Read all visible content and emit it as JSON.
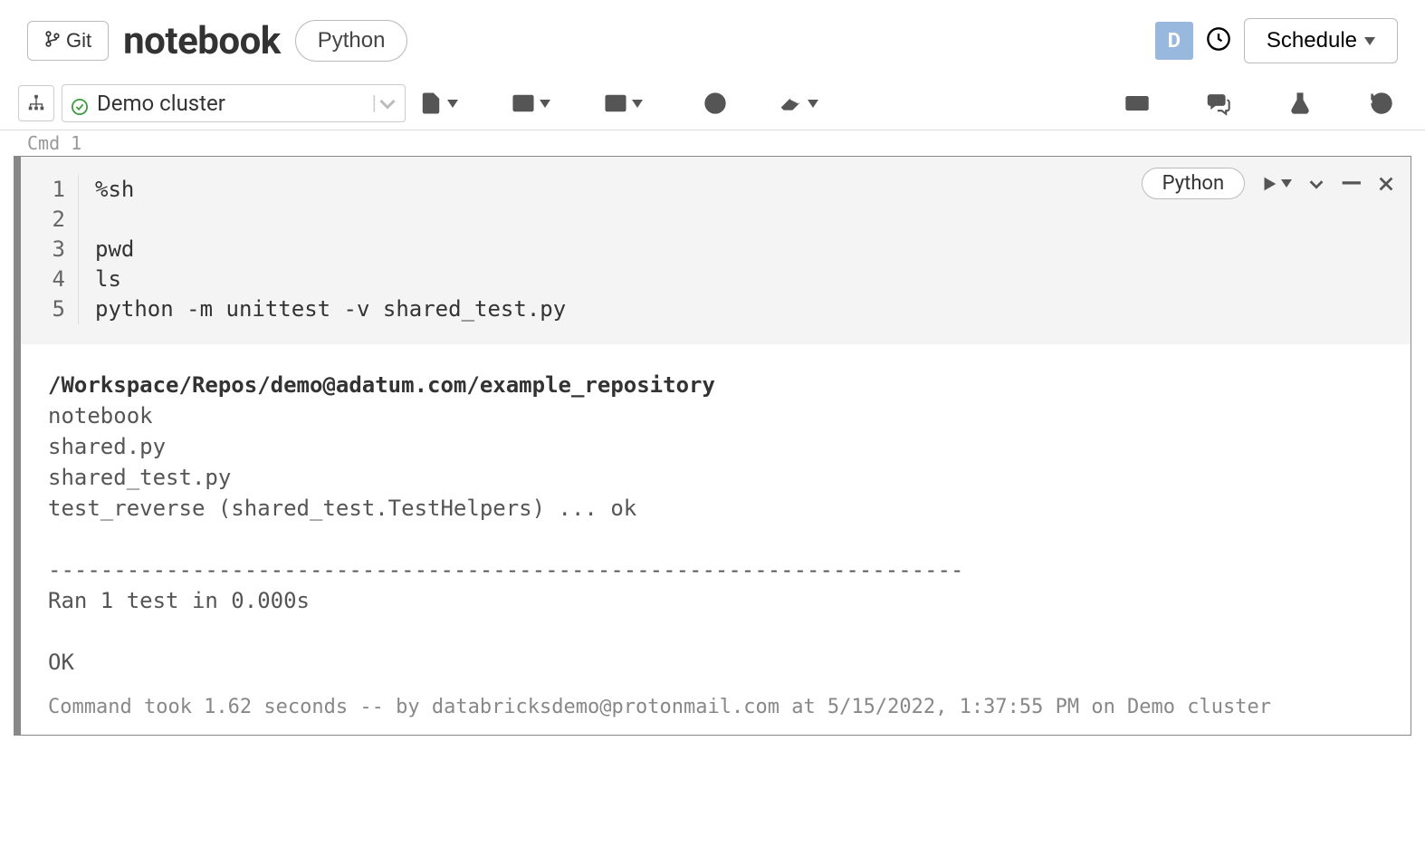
{
  "header": {
    "git_label": "Git",
    "title": "notebook",
    "language": "Python",
    "avatar_letter": "D",
    "schedule_label": "Schedule"
  },
  "toolbar": {
    "cluster_name": "Demo cluster"
  },
  "cmd_label": "Cmd 1",
  "cell": {
    "language_pill": "Python",
    "gutter": [
      "1",
      "2",
      "3",
      "4",
      "5"
    ],
    "code_lines": [
      "%sh",
      "",
      "pwd",
      "ls",
      "python -m unittest -v shared_test.py"
    ],
    "output": {
      "path": "/Workspace/Repos/demo@adatum.com/example_repository",
      "lines": [
        "notebook",
        "shared.py",
        "shared_test.py",
        "test_reverse (shared_test.TestHelpers) ... ok",
        "",
        "----------------------------------------------------------------------",
        "Ran 1 test in 0.000s",
        "",
        "OK"
      ]
    },
    "footer": "Command took 1.62 seconds -- by databricksdemo@protonmail.com at 5/15/2022, 1:37:55 PM on Demo cluster"
  }
}
